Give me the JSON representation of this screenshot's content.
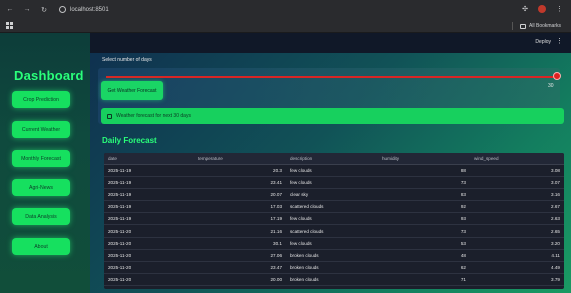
{
  "browser": {
    "url": "localhost:8501",
    "bookmarks_label": "All Bookmarks"
  },
  "topbar": {
    "deploy_label": "Deploy",
    "menu_glyph": "⋮"
  },
  "sidebar": {
    "title": "Dashboard",
    "items": [
      {
        "label": "Crop Prediction"
      },
      {
        "label": "Current Weather"
      },
      {
        "label": "Monthly Forecast"
      },
      {
        "label": "Agri-News"
      },
      {
        "label": "Data Analysis"
      },
      {
        "label": "About"
      }
    ]
  },
  "main": {
    "slider": {
      "label": "Select number of days",
      "value": "30"
    },
    "get_forecast_label": "Get Weather Forecast",
    "info_text": "Weather forecast for next 30 days",
    "section_title": "Daily Forecast",
    "table": {
      "headers": [
        "date",
        "temperature",
        "description",
        "humidity",
        "wind_speed"
      ],
      "rows": [
        [
          "2025-11-19",
          "20.3",
          "few clouds",
          "88",
          "3.08"
        ],
        [
          "2025-11-19",
          "23.41",
          "few clouds",
          "73",
          "3.07"
        ],
        [
          "2025-11-19",
          "20.07",
          "clear sky",
          "83",
          "3.16"
        ],
        [
          "2025-11-19",
          "17.03",
          "scattered clouds",
          "92",
          "2.67"
        ],
        [
          "2025-11-19",
          "17.19",
          "few clouds",
          "93",
          "2.63"
        ],
        [
          "2025-11-20",
          "21.16",
          "scattered clouds",
          "73",
          "2.65"
        ],
        [
          "2025-11-20",
          "30.1",
          "few clouds",
          "53",
          "3.20"
        ],
        [
          "2025-11-20",
          "27.06",
          "broken clouds",
          "48",
          "4.11"
        ],
        [
          "2025-11-20",
          "23.47",
          "broken clouds",
          "62",
          "4.49"
        ],
        [
          "2025-11-20",
          "20.00",
          "broken clouds",
          "71",
          "3.79"
        ]
      ]
    }
  },
  "colors": {
    "accent_green": "#16e05f",
    "title_green": "#2aff7a",
    "slider_red": "#d92525",
    "table_bg": "#1b1f2b"
  }
}
